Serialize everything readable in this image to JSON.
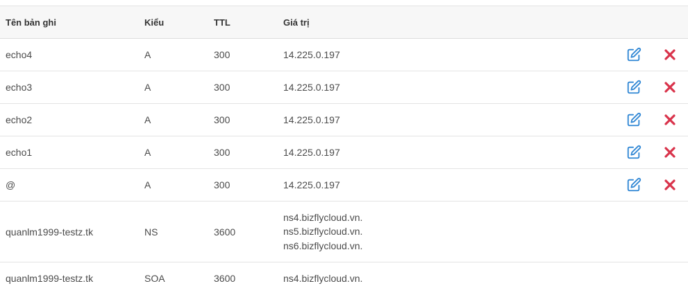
{
  "headers": {
    "name": "Tên bản ghi",
    "type": "Kiểu",
    "ttl": "TTL",
    "value": "Giá trị"
  },
  "records": [
    {
      "name": "echo4",
      "type": "A",
      "ttl": "300",
      "values": [
        "14.225.0.197"
      ],
      "editable": true
    },
    {
      "name": "echo3",
      "type": "A",
      "ttl": "300",
      "values": [
        "14.225.0.197"
      ],
      "editable": true
    },
    {
      "name": "echo2",
      "type": "A",
      "ttl": "300",
      "values": [
        "14.225.0.197"
      ],
      "editable": true
    },
    {
      "name": "echo1",
      "type": "A",
      "ttl": "300",
      "values": [
        "14.225.0.197"
      ],
      "editable": true
    },
    {
      "name": "@",
      "type": "A",
      "ttl": "300",
      "values": [
        "14.225.0.197"
      ],
      "editable": true
    },
    {
      "name": "quanlm1999-testz.tk",
      "type": "NS",
      "ttl": "3600",
      "values": [
        "ns4.bizflycloud.vn.",
        "ns5.bizflycloud.vn.",
        "ns6.bizflycloud.vn."
      ],
      "editable": false
    },
    {
      "name": "quanlm1999-testz.tk",
      "type": "SOA",
      "ttl": "3600",
      "values": [
        "ns4.bizflycloud.vn."
      ],
      "editable": false
    }
  ],
  "icons": {
    "edit": "edit-icon",
    "delete": "close-icon"
  },
  "colors": {
    "edit": "#2f86d4",
    "delete": "#d9334b",
    "header_bg": "#f7f7f7"
  }
}
